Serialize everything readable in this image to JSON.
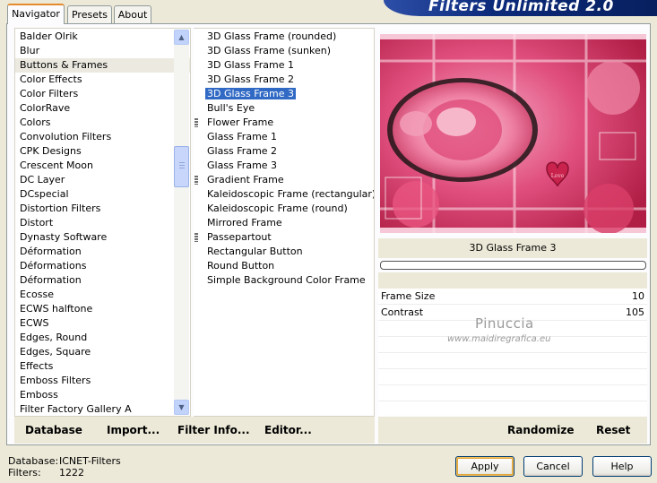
{
  "banner": {
    "title": "Filters Unlimited 2.0"
  },
  "tabs": [
    {
      "label": "Navigator"
    },
    {
      "label": "Presets"
    },
    {
      "label": "About"
    }
  ],
  "categories": {
    "selected": "Buttons & Frames",
    "items": [
      "Balder Olrik",
      "Blur",
      "Buttons & Frames",
      "Color Effects",
      "Color Filters",
      "ColorRave",
      "Colors",
      "Convolution Filters",
      "CPK Designs",
      "Crescent Moon",
      "DC Layer",
      "DCspecial",
      "Distortion Filters",
      "Distort",
      "Dynasty Software",
      "Déformation",
      "Déformations",
      "Déformation",
      "Ecosse",
      "ECWS halftone",
      "ECWS",
      "Edges, Round",
      "Edges, Square",
      "Effects",
      "Emboss Filters",
      "Emboss",
      "Filter Factory Gallery A"
    ]
  },
  "filters": {
    "selected": "3D Glass Frame 3",
    "items": [
      {
        "label": "3D Glass Frame (rounded)",
        "grip": false
      },
      {
        "label": "3D Glass Frame (sunken)",
        "grip": false
      },
      {
        "label": "3D Glass Frame 1",
        "grip": false
      },
      {
        "label": "3D Glass Frame 2",
        "grip": false
      },
      {
        "label": "3D Glass Frame 3",
        "grip": false
      },
      {
        "label": "Bull's Eye",
        "grip": false
      },
      {
        "label": "Flower Frame",
        "grip": true
      },
      {
        "label": "Glass Frame 1",
        "grip": false
      },
      {
        "label": "Glass Frame 2",
        "grip": false
      },
      {
        "label": "Glass Frame 3",
        "grip": false
      },
      {
        "label": "Gradient Frame",
        "grip": true
      },
      {
        "label": "Kaleidoscopic Frame (rectangular)",
        "grip": false
      },
      {
        "label": "Kaleidoscopic Frame (round)",
        "grip": false
      },
      {
        "label": "Mirrored Frame",
        "grip": false
      },
      {
        "label": "Passepartout",
        "grip": true
      },
      {
        "label": "Rectangular Button",
        "grip": false
      },
      {
        "label": "Round Button",
        "grip": false
      },
      {
        "label": "Simple Background Color Frame",
        "grip": false
      }
    ]
  },
  "bottom_links": {
    "database": "Database",
    "import": "Import...",
    "filter_info": "Filter Info...",
    "editor": "Editor..."
  },
  "preview": {
    "caption": "3D Glass Frame 3",
    "watermark_name": "Pinuccia",
    "watermark_url": "www.maidiregrafica.eu",
    "heart_text": "Love"
  },
  "params": [
    {
      "label": "Frame Size",
      "value": "10"
    },
    {
      "label": "Contrast",
      "value": "105"
    }
  ],
  "preview_actions": {
    "randomize": "Randomize",
    "reset": "Reset"
  },
  "status": {
    "database_label": "Database:",
    "database_value": "ICNET-Filters",
    "filters_label": "Filters:",
    "filters_value": "1222"
  },
  "dialog_buttons": {
    "apply": "Apply",
    "cancel": "Cancel",
    "help": "Help"
  },
  "colors": {
    "selection": "#316AC5",
    "tab_accent": "#E68B2C",
    "banner": "#0B2A7A",
    "dialog_bg": "#ECE9D8"
  }
}
